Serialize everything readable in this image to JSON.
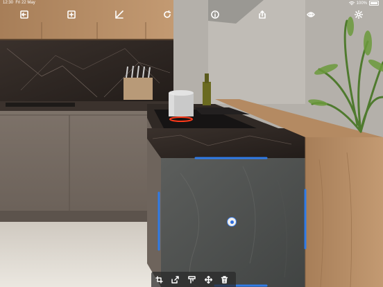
{
  "status_bar": {
    "time": "12:30",
    "date": "Fri 22 May",
    "battery": "100%"
  },
  "toolbar": {
    "items": [
      {
        "icon": "exit-icon"
      },
      {
        "icon": "add-icon"
      },
      {
        "icon": "measure-icon"
      },
      {
        "icon": "refresh-icon"
      },
      {
        "icon": "info-icon"
      },
      {
        "icon": "share-icon"
      },
      {
        "icon": "visibility-icon"
      },
      {
        "icon": "settings-icon"
      }
    ]
  },
  "edit_bar": {
    "items": [
      {
        "icon": "rotate-icon"
      },
      {
        "icon": "export-icon"
      },
      {
        "icon": "texture-icon"
      },
      {
        "icon": "move-icon"
      },
      {
        "icon": "delete-icon"
      }
    ]
  },
  "colors": {
    "selection": "#2f7be8",
    "toolbar_bg": "#2b2b2b"
  }
}
